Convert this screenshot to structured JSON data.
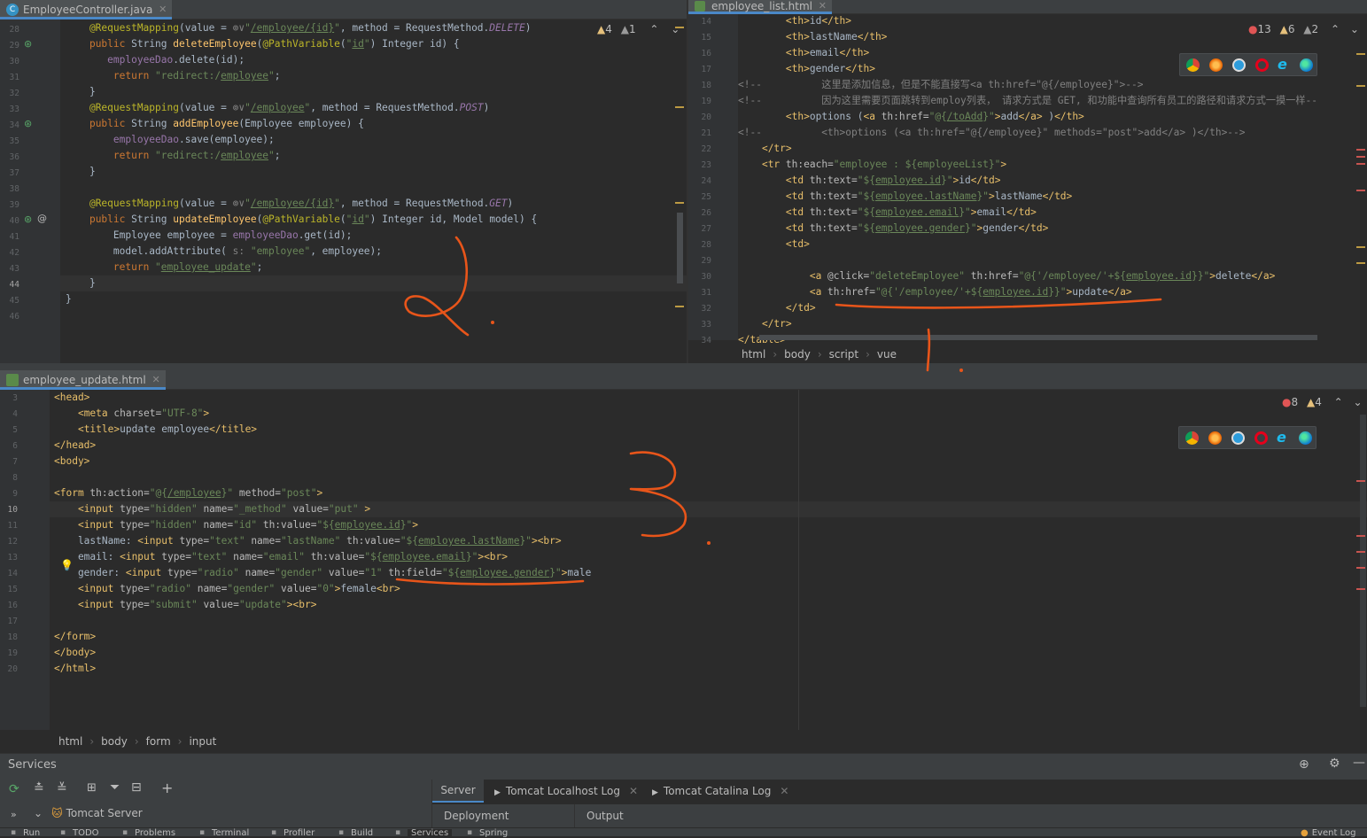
{
  "top_left": {
    "tab_label": "EmployeeController.java",
    "inspections": {
      "warnings": "4",
      "weak": "1"
    },
    "line_numbers": [
      "28",
      "29",
      "30",
      "31",
      "32",
      "33",
      "34",
      "35",
      "36",
      "37",
      "38",
      "39",
      "40",
      "41",
      "42",
      "43",
      "44",
      "45",
      "46"
    ]
  },
  "top_right": {
    "tab_label": "employee_list.html",
    "inspections": {
      "errors": "13",
      "warnings": "6",
      "weak": "2"
    },
    "line_numbers": [
      "14",
      "15",
      "16",
      "17",
      "18",
      "19",
      "20",
      "21",
      "22",
      "23",
      "24",
      "25",
      "26",
      "27",
      "28",
      "29",
      "30",
      "31",
      "32",
      "33",
      "34"
    ],
    "breadcrumbs": [
      "html",
      "body",
      "script",
      "vue"
    ]
  },
  "bottom_editor": {
    "tab_label": "employee_update.html",
    "inspections": {
      "errors": "8",
      "warnings": "4"
    },
    "line_numbers": [
      "3",
      "4",
      "5",
      "6",
      "7",
      "8",
      "9",
      "10",
      "11",
      "12",
      "13",
      "14",
      "15",
      "16",
      "17",
      "18",
      "19",
      "20"
    ],
    "breadcrumbs": [
      "html",
      "body",
      "form",
      "input"
    ]
  },
  "services": {
    "title": "Services",
    "tree_item": "Tomcat Server",
    "tabs": [
      "Server",
      "Tomcat Localhost Log",
      "Tomcat Catalina Log"
    ],
    "deployment_label": "Deployment",
    "output_label": "Output"
  },
  "status_bar": {
    "items": [
      "Run",
      "TODO",
      "Problems",
      "Terminal",
      "Profiler",
      "Build",
      "Services",
      "Spring"
    ],
    "event_log": "Event Log"
  },
  "annotations": [
    "2",
    "1",
    "3"
  ],
  "colors": {
    "accent": "#4a88c7",
    "ink": "#e8551a",
    "bg": "#2b2b2b",
    "gutter": "#313335"
  }
}
